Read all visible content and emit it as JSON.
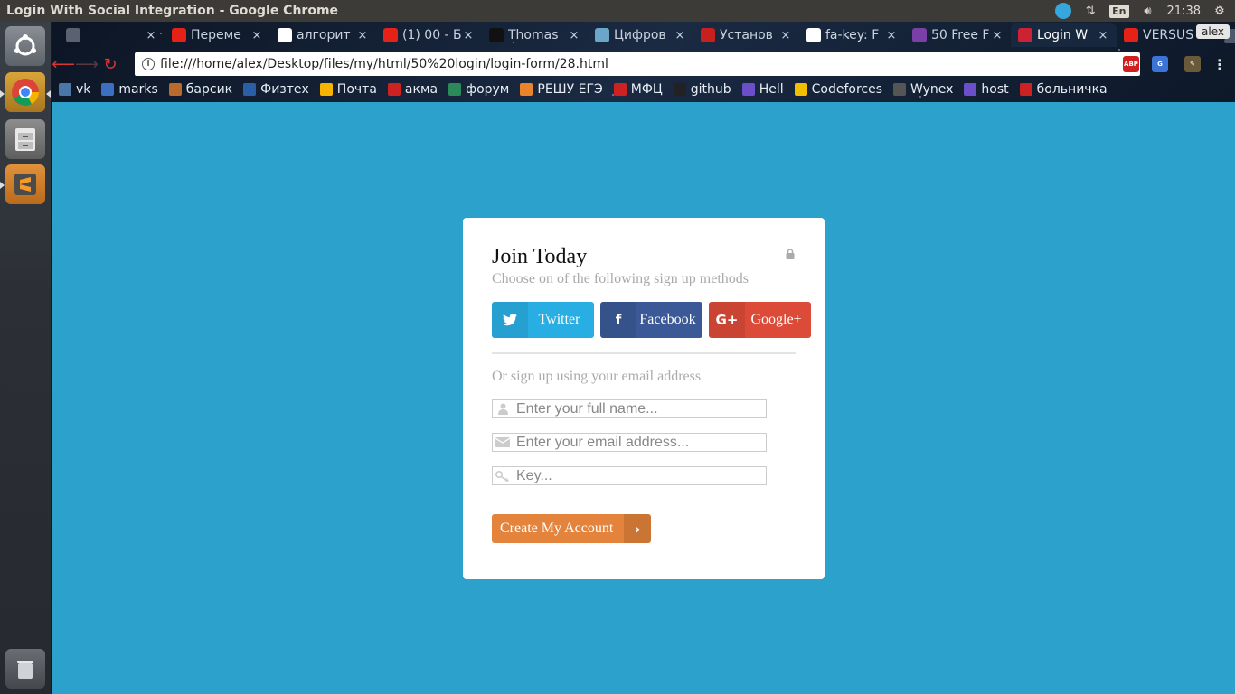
{
  "window": {
    "title": "Login With Social Integration - Google Chrome"
  },
  "tray": {
    "lang": "En",
    "clock": "21:38",
    "user": "alex"
  },
  "tabs": [
    {
      "label": "",
      "color": "#5a6170"
    },
    {
      "label": "Переме",
      "color": "#e62117"
    },
    {
      "label": "алгорит",
      "color": "#ffffff"
    },
    {
      "label": "(1) 00 - Б",
      "color": "#e62117"
    },
    {
      "label": "Thomas",
      "color": "#111111"
    },
    {
      "label": "Цифров",
      "color": "#6aa6c8"
    },
    {
      "label": "Установ",
      "color": "#c8201e"
    },
    {
      "label": "fa-key: F",
      "color": "#ffffff"
    },
    {
      "label": "50 Free F",
      "color": "#7b3fa8"
    },
    {
      "label": "Login W",
      "color": "#c23",
      "active": true
    },
    {
      "label": "VERSUS",
      "color": "#e62117"
    }
  ],
  "toolbar": {
    "url": "file:///home/alex/Desktop/files/my/html/50%20login/login-form/28.html"
  },
  "bookmarks": [
    {
      "label": "vk",
      "color": "#4a76a8"
    },
    {
      "label": "marks",
      "color": "#3a6fc2"
    },
    {
      "label": "барсик",
      "color": "#b86b2a"
    },
    {
      "label": "Физтех",
      "color": "#2a5fa8"
    },
    {
      "label": "Почта",
      "color": "#f5b400"
    },
    {
      "label": "акма",
      "color": "#c22"
    },
    {
      "label": "форум",
      "color": "#2a8a5a"
    },
    {
      "label": "РЕШУ ЕГЭ",
      "color": "#e8852a"
    },
    {
      "label": "МФЦ",
      "color": "#c22"
    },
    {
      "label": "github",
      "color": "#222"
    },
    {
      "label": "Hell",
      "color": "#6a4fc8"
    },
    {
      "label": "Codeforces",
      "color": "#f0c000"
    },
    {
      "label": "Wynex",
      "color": "#555"
    },
    {
      "label": "host",
      "color": "#6a4fc8"
    },
    {
      "label": "больничка",
      "color": "#c22"
    }
  ],
  "card": {
    "title": "Join Today",
    "subtitle": "Choose on of the following sign up methods",
    "social": {
      "twitter": "Twitter",
      "facebook": "Facebook",
      "google": "Google+"
    },
    "or_text": "Or sign up using your email address",
    "fields": {
      "name_placeholder": "Enter your full name...",
      "email_placeholder": "Enter your email address...",
      "key_placeholder": "Key..."
    },
    "create_label": "Create My Account"
  },
  "colors": {
    "page_bg": "#2ba1cc",
    "twitter": "#29aee3",
    "facebook": "#3b5997",
    "google": "#dc4a38",
    "cta": "#e3833c"
  }
}
